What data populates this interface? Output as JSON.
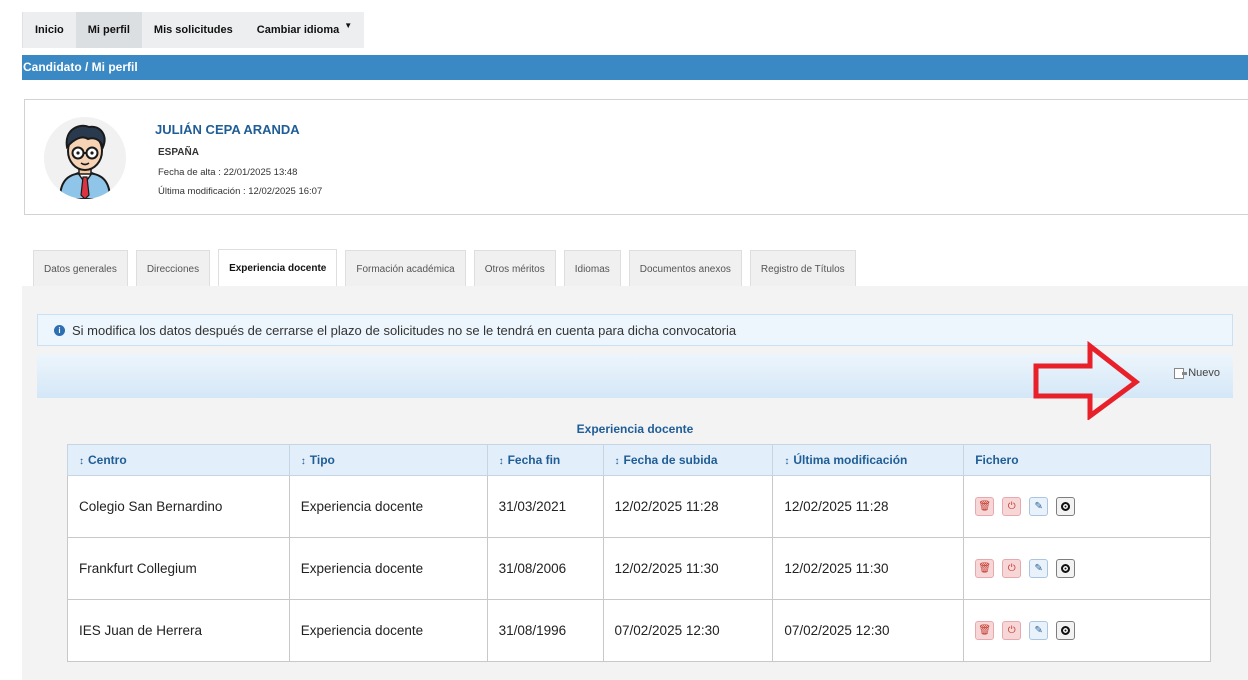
{
  "nav": {
    "items": [
      {
        "label": "Inicio",
        "active": false
      },
      {
        "label": "Mi perfil",
        "active": true
      },
      {
        "label": "Mis solicitudes",
        "active": false
      },
      {
        "label": "Cambiar idioma",
        "active": false,
        "dropdown": true
      }
    ]
  },
  "breadcrumb": "Candidato / Mi perfil",
  "profile": {
    "name": "JULIÁN CEPA ARANDA",
    "country": "ESPAÑA",
    "fecha_alta": "Fecha de alta : 22/01/2025 13:48",
    "ultima_mod": "Última modificación : 12/02/2025 16:07"
  },
  "tabs": [
    {
      "label": "Datos generales",
      "active": false
    },
    {
      "label": "Direcciones",
      "active": false
    },
    {
      "label": "Experiencia docente",
      "active": true
    },
    {
      "label": "Formación académica",
      "active": false
    },
    {
      "label": "Otros méritos",
      "active": false
    },
    {
      "label": "Idiomas",
      "active": false
    },
    {
      "label": "Documentos anexos",
      "active": false
    },
    {
      "label": "Registro de Títulos",
      "active": false
    }
  ],
  "alert": {
    "icon": "info-icon",
    "text": "Si modifica los datos después de cerrarse el plazo de solicitudes no se le tendrá en cuenta para dicha convocatoria"
  },
  "toolbar": {
    "nuevo_label": "Nuevo"
  },
  "table": {
    "caption": "Experiencia docente",
    "columns": [
      {
        "label": "Centro",
        "sortable": true
      },
      {
        "label": "Tipo",
        "sortable": true
      },
      {
        "label": "Fecha fin",
        "sortable": true
      },
      {
        "label": "Fecha de subida",
        "sortable": true
      },
      {
        "label": "Última modificación",
        "sortable": true
      },
      {
        "label": "Fichero",
        "sortable": false
      }
    ],
    "rows": [
      {
        "centro": "Colegio San Bernardino",
        "tipo": "Experiencia docente",
        "fecha_fin": "31/03/2021",
        "fecha_subida": "12/02/2025 11:28",
        "ultima_mod": "12/02/2025 11:28"
      },
      {
        "centro": "Frankfurt Collegium",
        "tipo": "Experiencia docente",
        "fecha_fin": "31/08/2006",
        "fecha_subida": "12/02/2025 11:30",
        "ultima_mod": "12/02/2025 11:30"
      },
      {
        "centro": "IES Juan de Herrera",
        "tipo": "Experiencia docente",
        "fecha_fin": "31/08/1996",
        "fecha_subida": "07/02/2025 12:30",
        "ultima_mod": "07/02/2025 12:30"
      }
    ],
    "sort_glyph": "↕",
    "actions": [
      {
        "icon": "delete-icon",
        "glyph": "🗑",
        "style": "pink"
      },
      {
        "icon": "power-icon",
        "glyph": "⏻",
        "style": "pink"
      },
      {
        "icon": "edit-icon",
        "glyph": "✎",
        "style": "blue"
      },
      {
        "icon": "view-icon",
        "glyph": "",
        "style": "dark"
      }
    ]
  },
  "colors": {
    "header_bar": "#3a89c5",
    "link_blue": "#1f5d96",
    "annotation_arrow": "#e8202a"
  }
}
